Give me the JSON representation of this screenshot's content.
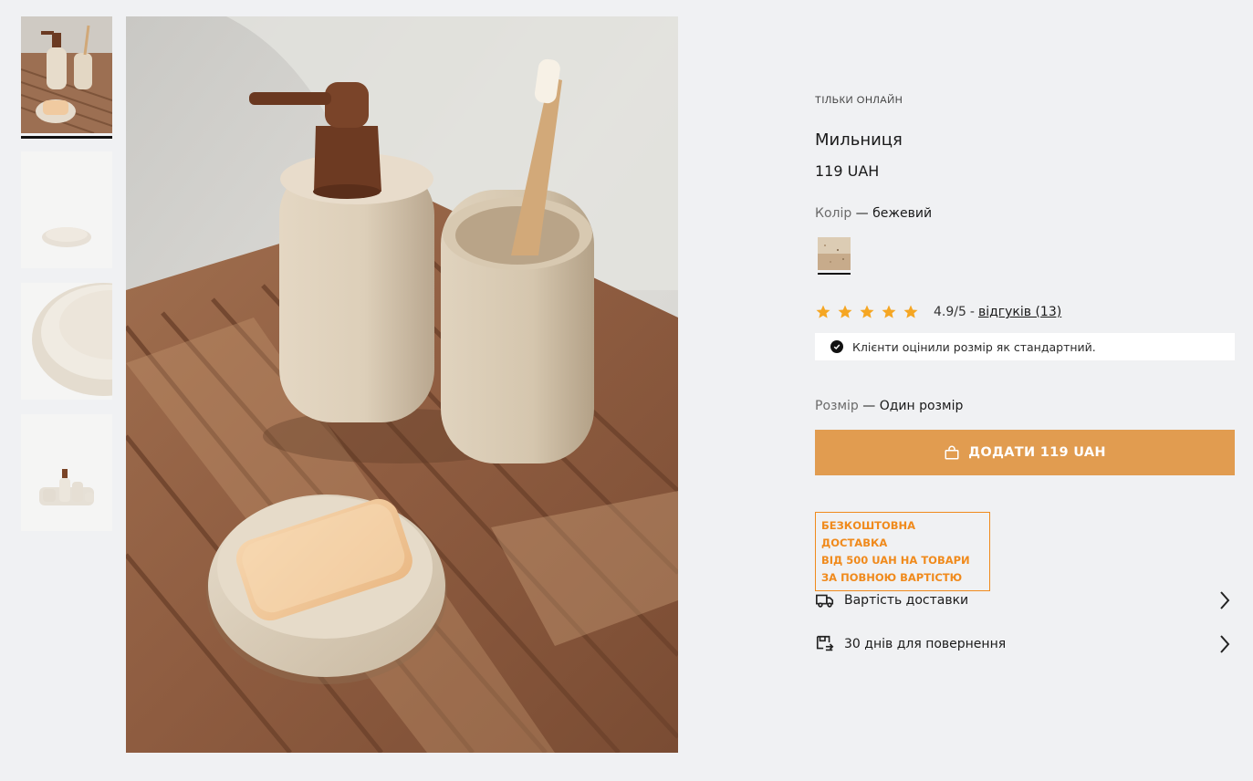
{
  "gallery": {
    "thumbnails": [
      {
        "alt": "set",
        "active": true
      },
      {
        "alt": "dish-top",
        "active": false
      },
      {
        "alt": "dish-close",
        "active": false
      },
      {
        "alt": "set-white",
        "active": false
      }
    ]
  },
  "product": {
    "tag": "ТІЛЬКИ ОНЛАЙН",
    "title": "Мильниця",
    "price": "119 UAH",
    "color_label": "Колір",
    "color_separator": " — ",
    "color_value": "бежевий",
    "rating": {
      "stars": 5,
      "score": "4.9/5",
      "separator": "-",
      "reviews_link": "відгуків (13)"
    },
    "fit_note": "Клієнти оцінили розмір як стандартний.",
    "size_label": "Розмір",
    "size_separator": " — ",
    "size_value": "Один розмір",
    "add_button": "ДОДАТИ 119 UAH",
    "promo_lines": [
      "БЕЗКОШТОВНА ДОСТАВКА",
      "ВІД 500 UAH НА ТОВАРИ",
      "ЗА ПОВНОЮ ВАРТІСТЮ"
    ],
    "delivery_row": "Вартість доставки",
    "returns_row": "30 днів для повернення"
  },
  "colors": {
    "accent": "#e19c50",
    "promo": "#f08a1c",
    "star": "#f5a623",
    "background": "#f0f1f3"
  },
  "icons": {
    "bag": "bag-icon",
    "truck": "truck-icon",
    "returns": "returns-icon",
    "chevron": "chevron-right-icon",
    "check": "check-circle-icon",
    "star": "star-icon"
  }
}
